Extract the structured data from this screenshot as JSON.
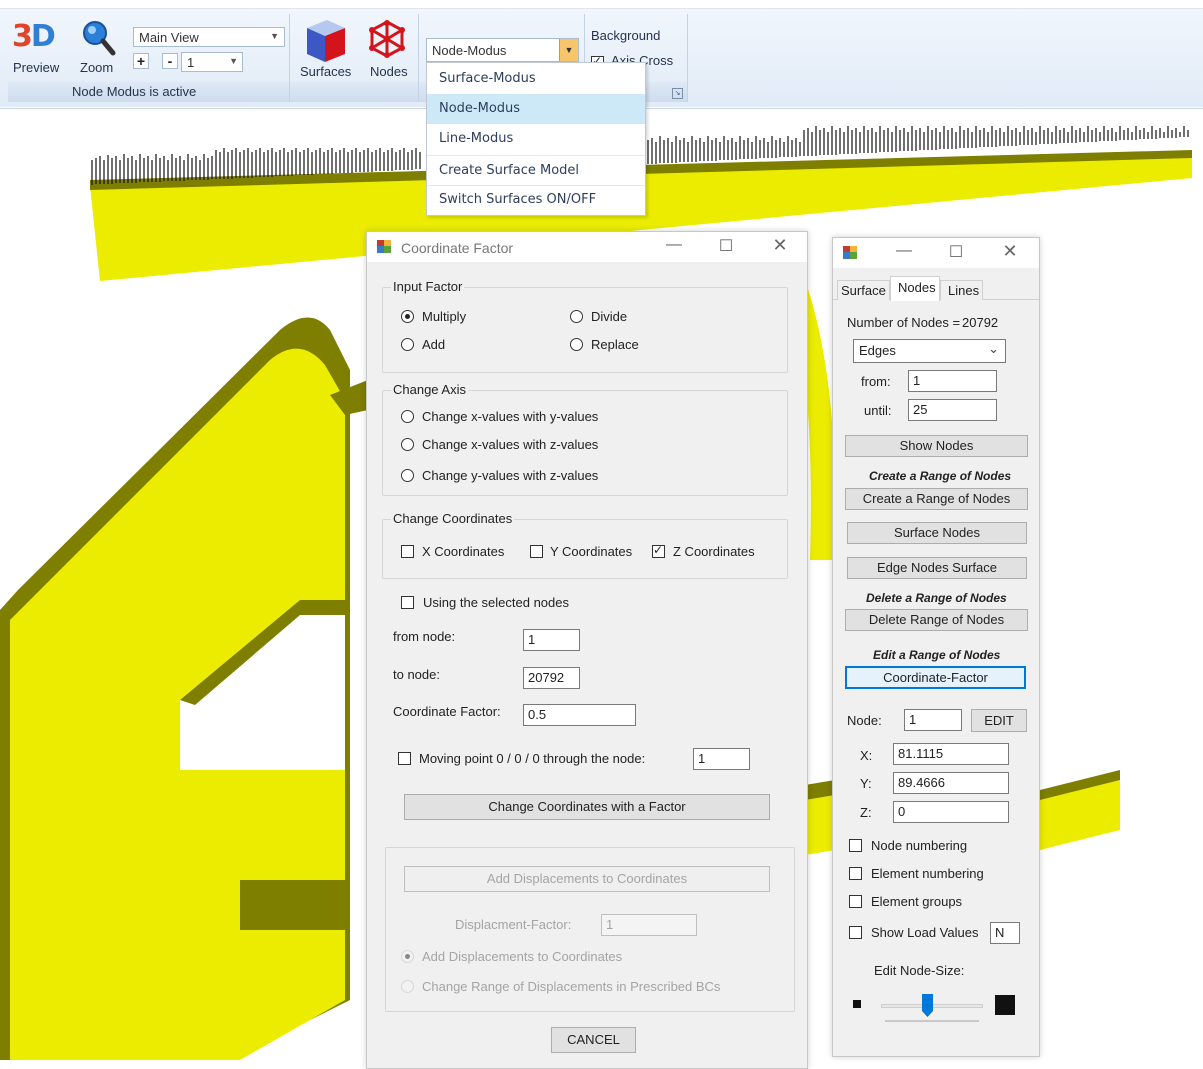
{
  "ribbon": {
    "preview_label": "Preview",
    "zoom_label": "Zoom",
    "view_combo": "Main View",
    "plus": "+",
    "minus": "-",
    "step_value": "1",
    "surfaces_label": "Surfaces",
    "nodes_label": "Nodes",
    "modus_combo": "Node-Modus",
    "background_label": "Background",
    "axis_cross_label": "Axis Cross",
    "status_caption": "Node Modus is active"
  },
  "modus_menu": {
    "items": [
      "Surface-Modus",
      "Node-Modus",
      "Line-Modus",
      "Create Surface Model",
      "Switch Surfaces ON/OFF"
    ],
    "selected": "Node-Modus"
  },
  "coord_dialog": {
    "title": "Coordinate Factor",
    "input_factor": {
      "title": "Input Factor",
      "multiply": "Multiply",
      "divide": "Divide",
      "add": "Add",
      "replace": "Replace",
      "selected": "Multiply"
    },
    "change_axis": {
      "title": "Change Axis",
      "xy": "Change x-values with y-values",
      "xz": "Change x-values with z-values",
      "yz": "Change y-values with z-values"
    },
    "change_coords": {
      "title": "Change Coordinates",
      "x": "X Coordinates",
      "y": "Y Coordinates",
      "z": "Z Coordinates",
      "z_checked": true
    },
    "using_selected": "Using the selected nodes",
    "from_node_label": "from node:",
    "from_node_value": "1",
    "to_node_label": "to node:",
    "to_node_value": "20792",
    "factor_label": "Coordinate Factor:",
    "factor_value": "0.5",
    "moving_point_label": "Moving point 0 / 0 / 0 through the node:",
    "moving_point_value": "1",
    "change_button": "Change Coordinates with a Factor",
    "add_disp_button": "Add Displacements to Coordinates",
    "disp_factor_label": "Displacment-Factor:",
    "disp_factor_value": "1",
    "radio_add_disp": "Add Displacements to Coordinates",
    "radio_change_range": "Change Range of Displacements in Prescribed BCs",
    "cancel": "CANCEL"
  },
  "nodes_panel": {
    "tabs": [
      "Surface",
      "Nodes",
      "Lines"
    ],
    "active_tab": "Nodes",
    "node_count_label": "Number of Nodes =",
    "node_count": "20792",
    "combo_value": "Edges",
    "from_label": "from:",
    "from_value": "1",
    "until_label": "until:",
    "until_value": "25",
    "show_nodes": "Show Nodes",
    "create_range_heading": "Create a Range of Nodes",
    "create_range_button": "Create a Range of Nodes",
    "surface_nodes": "Surface Nodes",
    "edge_nodes_surface": "Edge Nodes Surface",
    "delete_range_heading": "Delete a Range of Nodes",
    "delete_range_button": "Delete Range of Nodes",
    "edit_range_heading": "Edit a Range of Nodes",
    "coordinate_factor_button": "Coordinate-Factor",
    "node_label": "Node:",
    "node_value": "1",
    "edit_button": "EDIT",
    "x_label": "X:",
    "x_value": "81.1115",
    "y_label": "Y:",
    "y_value": "89.4666",
    "z_label": "Z:",
    "z_value": "0",
    "node_numbering": "Node numbering",
    "element_numbering": "Element numbering",
    "element_groups": "Element groups",
    "show_load_values": "Show Load Values",
    "load_unit": "N",
    "edit_node_size": "Edit Node-Size:",
    "node_size_level": 0.45
  },
  "colors": {
    "model_face": "#ecec00",
    "model_side": "#7e7e00",
    "selected_menu": "#cde9f7"
  }
}
